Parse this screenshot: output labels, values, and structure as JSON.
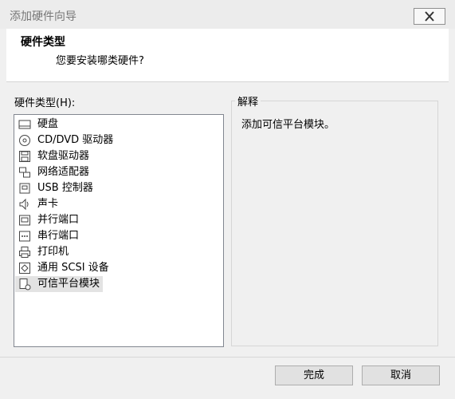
{
  "window": {
    "title": "添加硬件向导"
  },
  "header": {
    "title": "硬件类型",
    "subtitle": "您要安装哪类硬件?"
  },
  "list": {
    "label": "硬件类型(H):",
    "items": [
      {
        "label": "硬盘",
        "icon": "hard-disk-icon"
      },
      {
        "label": "CD/DVD 驱动器",
        "icon": "cd-dvd-icon"
      },
      {
        "label": "软盘驱动器",
        "icon": "floppy-icon"
      },
      {
        "label": "网络适配器",
        "icon": "network-adapter-icon"
      },
      {
        "label": "USB 控制器",
        "icon": "usb-icon"
      },
      {
        "label": "声卡",
        "icon": "speaker-icon"
      },
      {
        "label": "并行端口",
        "icon": "parallel-port-icon"
      },
      {
        "label": "串行端口",
        "icon": "serial-port-icon"
      },
      {
        "label": "打印机",
        "icon": "printer-icon"
      },
      {
        "label": "通用 SCSI 设备",
        "icon": "scsi-icon"
      },
      {
        "label": "可信平台模块",
        "icon": "tpm-icon",
        "selected": true
      }
    ]
  },
  "explanation": {
    "label": "解释",
    "text": "添加可信平台模块。"
  },
  "buttons": {
    "finish": "完成",
    "cancel": "取消"
  }
}
